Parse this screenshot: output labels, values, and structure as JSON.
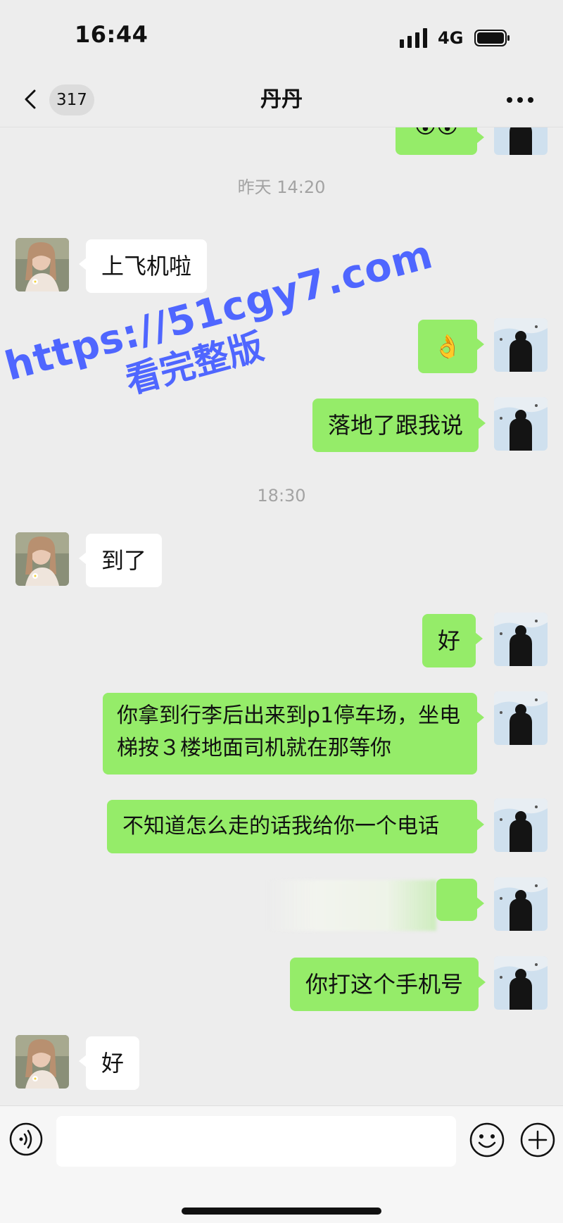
{
  "status_bar": {
    "time": "16:44",
    "network": "4G",
    "signal_icon": "signal-bars-icon",
    "battery_icon": "battery-icon"
  },
  "nav": {
    "back_icon": "chevron-left-icon",
    "unread_count": "317",
    "title": "丹丹",
    "more_icon": "more-horizontal-icon"
  },
  "chat": {
    "timestamps": [
      "昨天 14:20",
      "18:30"
    ],
    "messages": [
      {
        "from": "me",
        "kind": "emoji",
        "text": "😵😵"
      },
      {
        "from": "her",
        "kind": "text",
        "text": "上飞机啦"
      },
      {
        "from": "me",
        "kind": "emoji",
        "text": "👌"
      },
      {
        "from": "me",
        "kind": "text",
        "text": "落地了跟我说"
      },
      {
        "from": "her",
        "kind": "text",
        "text": "到了"
      },
      {
        "from": "me",
        "kind": "text",
        "text": "好"
      },
      {
        "from": "me",
        "kind": "text",
        "text": "你拿到行李后出来到p1停车场，坐电梯按３楼地面司机就在那等你"
      },
      {
        "from": "me",
        "kind": "text",
        "text": "不知道怎么走的话我给你一个电话"
      },
      {
        "from": "me",
        "kind": "redacted",
        "text": ""
      },
      {
        "from": "me",
        "kind": "text",
        "text": "你打这个手机号"
      },
      {
        "from": "her",
        "kind": "text",
        "text": "好"
      }
    ]
  },
  "watermark": {
    "line1": "https://51cgy7.com",
    "line2": "看完整版"
  },
  "input_bar": {
    "voice_icon": "voice-icon",
    "input_value": "",
    "emoji_icon": "smiley-icon",
    "plus_icon": "plus-circle-icon"
  },
  "colors": {
    "background": "#ededed",
    "my_bubble": "#95ec69",
    "her_bubble": "#ffffff",
    "watermark": "#4f66ff"
  }
}
